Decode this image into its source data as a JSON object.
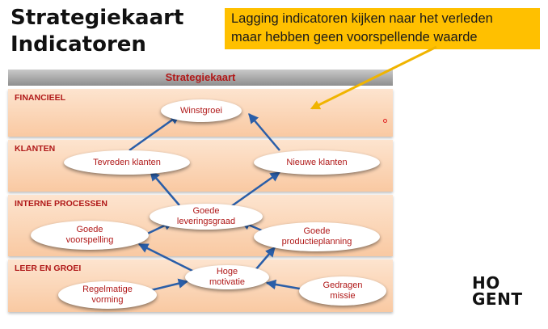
{
  "title": {
    "line1": "Strategiekaart",
    "line2": "Indicatoren"
  },
  "callout": {
    "line1": "Lagging indicatoren kijken naar het verleden",
    "line2": "maar hebben geen voorspellende waarde"
  },
  "map": {
    "header": "Strategiekaart",
    "bands": {
      "financieel": "FINANCIEEL",
      "klanten": "KLANTEN",
      "interne_processen": "INTERNE PROCESSEN",
      "leer_en_groei": "LEER EN GROEI"
    },
    "nodes": {
      "winstgroei": "Winstgroei",
      "tevreden_klanten": "Tevreden klanten",
      "nieuwe_klanten": "Nieuwe klanten",
      "goede_leveringsgraad": [
        "Goede",
        "leveringsgraad"
      ],
      "goede_voorspelling": [
        "Goede",
        "voorspelling"
      ],
      "goede_productieplanning": [
        "Goede",
        "productieplanning"
      ],
      "hoge_motivatie": [
        "Hoge",
        "motivatie"
      ],
      "regelmatige_vorming": [
        "Regelmatige",
        "vorming"
      ],
      "gedragen_missie": [
        "Gedragen",
        "missie"
      ]
    }
  },
  "colors": {
    "callout": "#ffc000",
    "label_red": "#b01818",
    "arrow_blue": "#2a5ea8",
    "band": "#fbd5b5"
  },
  "logo": {
    "line1": "HO",
    "line2": "GENT"
  }
}
